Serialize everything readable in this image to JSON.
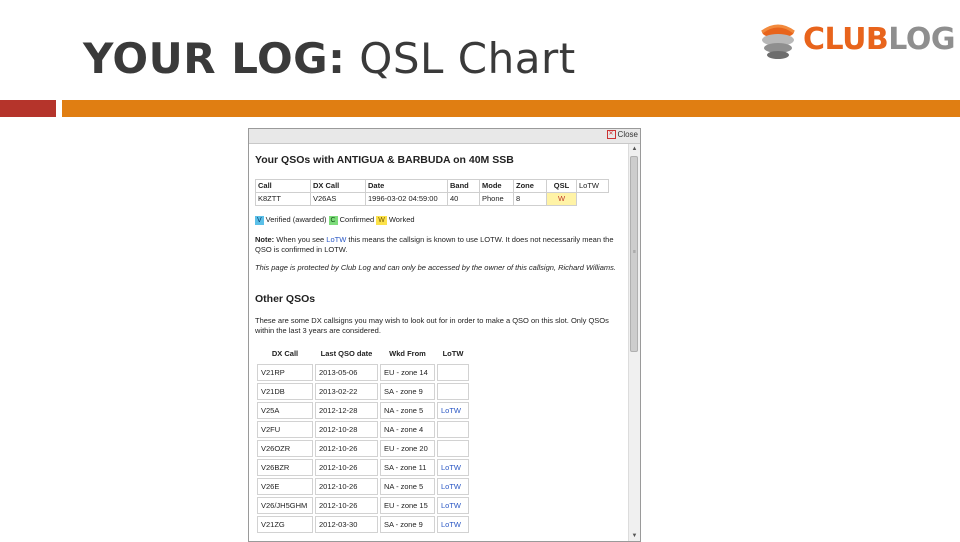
{
  "slide": {
    "title_bold": "YOUR LOG:",
    "title_rest": " QSL Chart",
    "logo": {
      "club": "CLUB",
      "log": "LOG"
    }
  },
  "colors": {
    "accent": "#e07e12",
    "accent_dark": "#b5342b",
    "link": "#2a57c4"
  },
  "popup": {
    "close_label": "Close",
    "heading": "Your QSOs with ANTIGUA & BARBUDA on 40M SSB",
    "qso_table": {
      "headers": [
        "Call",
        "DX Call",
        "Date",
        "Band",
        "Mode",
        "Zone",
        "QSL",
        "LoTW"
      ],
      "rows": [
        [
          "K8ZTT",
          "V26AS",
          "1996-03-02 04:59:00",
          "40",
          "Phone",
          "8",
          "W"
        ]
      ]
    },
    "legend": {
      "v": "V",
      "v_label": "Verified (awarded)",
      "c": "C",
      "c_label": "Confirmed",
      "w": "W",
      "w_label": "Worked"
    },
    "note": {
      "label": "Note:",
      "pre": " When you see ",
      "link": "LoTW",
      "post": " this means the callsign is known to use LOTW. It does not necessarily mean the QSO is confirmed in LOTW."
    },
    "protected_text": "This page is protected by Club Log and can only be accessed by the owner of this callsign, Richard Williams.",
    "other_heading": "Other QSOs",
    "other_intro": "These are some DX callsigns you may wish to look out for in order to make a QSO on this slot. Only QSOs within the last 3 years are considered.",
    "other_table": {
      "headers": [
        "DX Call",
        "Last QSO date",
        "Wkd From",
        "LoTW"
      ],
      "rows": [
        [
          "V21RP",
          "2013-05-06",
          "EU - zone 14",
          ""
        ],
        [
          "V21DB",
          "2013-02-22",
          "SA - zone 9",
          ""
        ],
        [
          "V25A",
          "2012-12-28",
          "NA - zone 5",
          "LoTW"
        ],
        [
          "V2FU",
          "2012-10-28",
          "NA - zone 4",
          ""
        ],
        [
          "V26OZR",
          "2012-10-26",
          "EU - zone 20",
          ""
        ],
        [
          "V26BZR",
          "2012-10-26",
          "SA - zone 11",
          "LoTW"
        ],
        [
          "V26E",
          "2012-10-26",
          "NA - zone 5",
          "LoTW"
        ],
        [
          "V26/JH5GHM",
          "2012-10-26",
          "EU - zone 15",
          "LoTW"
        ],
        [
          "V21ZG",
          "2012-03-30",
          "SA - zone 9",
          "LoTW"
        ]
      ]
    }
  }
}
